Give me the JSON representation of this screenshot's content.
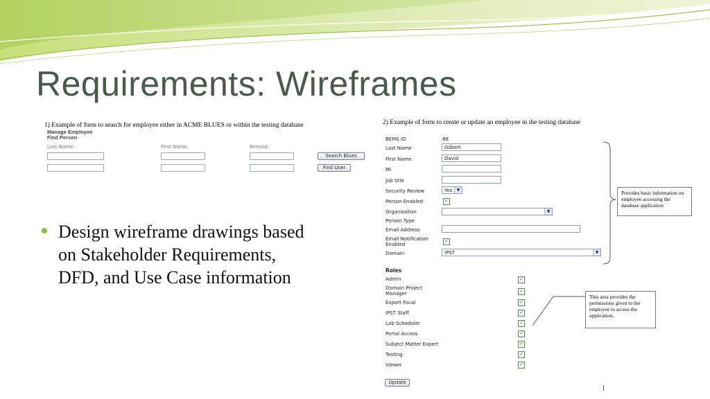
{
  "slide": {
    "title": "Requirements: Wireframes",
    "bullet": "Design wireframe drawings based on Stakeholder Requirements, DFD, and Use Case information",
    "accent_color": "#8dbe3c"
  },
  "wireframe1": {
    "caption": "1) Example of form to search for employee either in ACME BLUES or within the testing database",
    "heading1": "Manage Employee",
    "heading2": "Find Person",
    "labels": [
      "Last Name",
      "First Name:",
      "Bemsid:"
    ],
    "search_button": "Search Blues",
    "find_button": "Find User"
  },
  "wireframe2": {
    "caption": "2) Example of form to create or update an employee in the testing database",
    "fields": {
      "bems_id": {
        "label": "BEMS ID",
        "value": "88"
      },
      "last_name": {
        "label": "Last Name",
        "value": "Gilbert"
      },
      "first_name": {
        "label": "First Name",
        "value": "David"
      },
      "mi": {
        "label": "MI",
        "value": ""
      },
      "job_title": {
        "label": "Job title",
        "value": ""
      },
      "security_review": {
        "label": "Security Review",
        "value": "Yes"
      },
      "person_enabled": {
        "label": "Person Enabled",
        "checked": true
      },
      "organization": {
        "label": "Organization",
        "value": ""
      },
      "person_type": {
        "label": "Person Type",
        "value": ""
      },
      "email_address": {
        "label": "Email Address",
        "value": ""
      },
      "email_notification": {
        "label": "Email Notification Enabled",
        "checked": true
      },
      "domain": {
        "label": "Domain",
        "value": "IPST"
      }
    },
    "roles_heading": "Roles",
    "roles": [
      {
        "label": "Admin",
        "checked": true
      },
      {
        "label": "Domain Project Manager",
        "checked": true
      },
      {
        "label": "Export Focal",
        "checked": true
      },
      {
        "label": "IPST Staff",
        "checked": true
      },
      {
        "label": "Lab Scheduler",
        "checked": true
      },
      {
        "label": "Portal Access",
        "checked": true
      },
      {
        "label": "Subject Matter Expert",
        "checked": true
      },
      {
        "label": "Testing",
        "checked": true
      },
      {
        "label": "Viewer",
        "checked": true
      }
    ],
    "update_button": "Update",
    "note1": "Provides basic information on employee accessing the database application",
    "note2": "This area provides the permissions given to the employee to access the application."
  }
}
